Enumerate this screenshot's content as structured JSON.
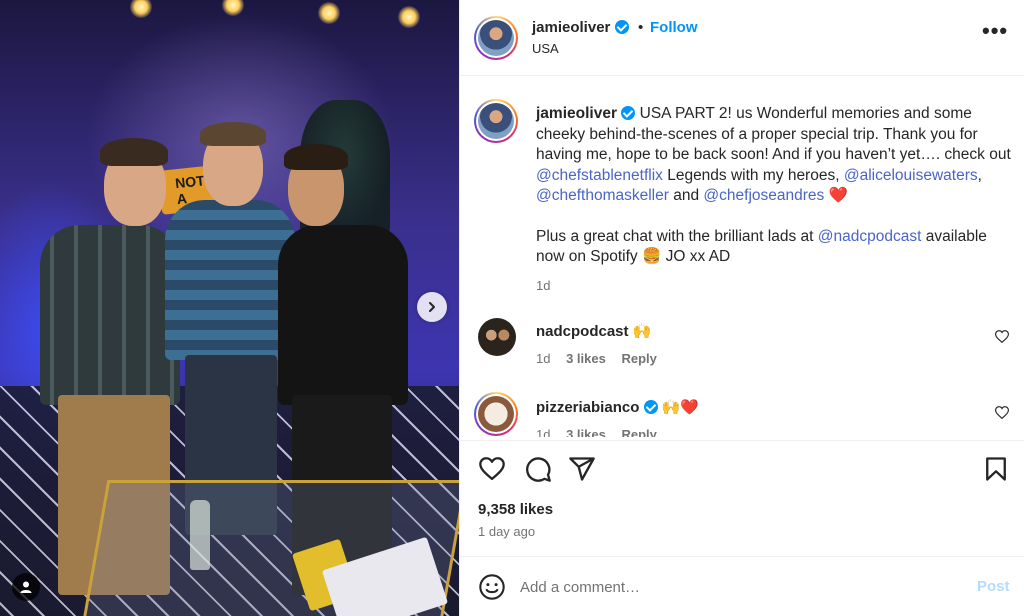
{
  "post": {
    "author": "jamieoliver",
    "location": "USA",
    "follow_label": "Follow",
    "separator": "•",
    "more_icon": "•••"
  },
  "caption": {
    "author": "jamieoliver",
    "text1": "USA PART 2! us Wonderful memories and some cheeky behind-the-scenes of a proper special trip. Thank you for having me, hope to be back soon! And if you haven’t yet…. check out",
    "mention1": "@chefstablenetflix",
    "text2": "Legends with my heroes,",
    "mention2": "@alicelouisewaters",
    "comma": ",",
    "mention3": "@chefthomaskeller",
    "and_word": "and",
    "mention4": "@chefjoseandres",
    "heart": "❤️",
    "text3": "Plus a great chat with the brilliant lads at",
    "mention5": "@nadcpodcast",
    "text4": "available now on Spotify",
    "burger": "🍔",
    "signoff": "JO xx AD",
    "time": "1d"
  },
  "comments": [
    {
      "user": "nadcpodcast",
      "emoji": "🙌",
      "time": "1d",
      "likes": "3 likes",
      "reply": "Reply"
    },
    {
      "user": "pizzeriabianco",
      "emoji": "🙌❤️",
      "time": "1d",
      "likes": "3 likes",
      "reply": "Reply"
    }
  ],
  "stats": {
    "likes": "9,358 likes",
    "posted": "1 day ago"
  },
  "photo": {
    "sign_text": "NOT A"
  },
  "composer": {
    "placeholder": "Add a comment…",
    "post_label": "Post"
  },
  "colors": {
    "accent": "#0095f6",
    "mention": "#4a64c8",
    "muted": "#737373",
    "heart": "#e0245e"
  }
}
